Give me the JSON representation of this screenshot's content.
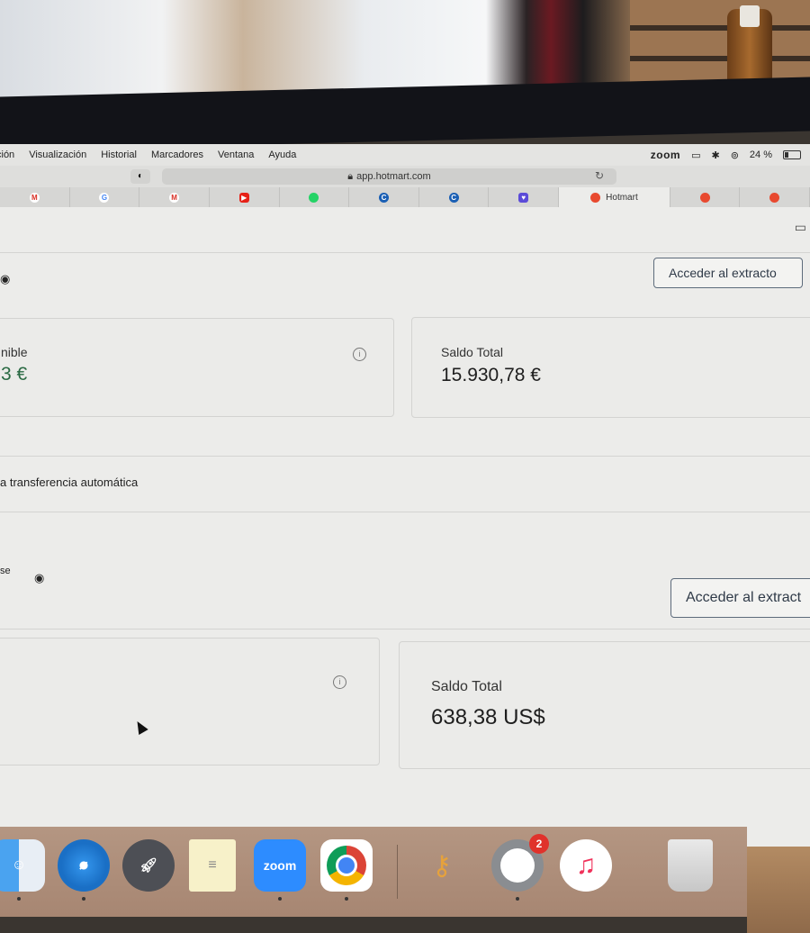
{
  "browser": {
    "menus": [
      "ción",
      "Visualización",
      "Historial",
      "Marcadores",
      "Ventana",
      "Ayuda"
    ],
    "status_zoom": "zoom",
    "battery": "24 %",
    "url": "app.hotmart.com",
    "tabs": [
      {
        "icon": "gmail-icon",
        "label": ""
      },
      {
        "icon": "google-icon",
        "label": ""
      },
      {
        "icon": "gmail-icon",
        "label": ""
      },
      {
        "icon": "youtube-icon",
        "label": ""
      },
      {
        "icon": "whatsapp-icon",
        "label": ""
      },
      {
        "icon": "c-app-icon",
        "label": ""
      },
      {
        "icon": "c-app-icon",
        "label": ""
      },
      {
        "icon": "chat-icon",
        "label": ""
      },
      {
        "icon": "hotmart-icon",
        "label": "Hotmart"
      },
      {
        "icon": "hotmart-icon",
        "label": ""
      },
      {
        "icon": "hotmart-icon",
        "label": ""
      }
    ]
  },
  "account_eur": {
    "extract_button": "Acceder al extracto",
    "available_label": "nible",
    "available_value": "3 €",
    "total_label": "Saldo Total",
    "total_value": "15.930,78 €"
  },
  "auto_transfer_text": "a transferencia automática",
  "account_usd": {
    "header_fragment": "se",
    "extract_button": "Acceder al extract",
    "total_label": "Saldo Total",
    "total_value": "638,38 US$"
  },
  "dock": {
    "whatsapp_badge": "2",
    "zoom_label": "zoom"
  },
  "colors": {
    "accent_green": "#2a6a43",
    "button_border": "#5d6b7b",
    "hotmart_red": "#e8492f"
  }
}
